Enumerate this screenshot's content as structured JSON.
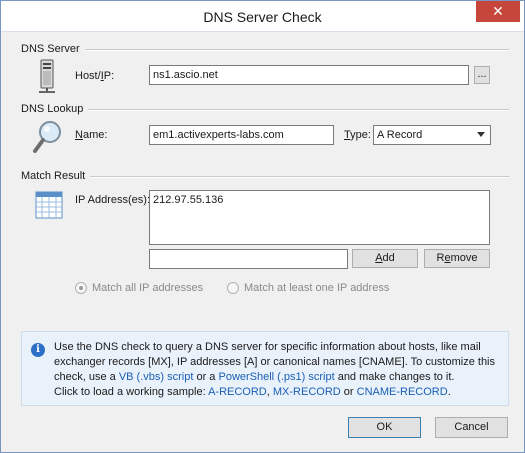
{
  "window": {
    "title": "DNS Server Check",
    "close_glyph": "✕"
  },
  "dns_server": {
    "section_label": "DNS Server",
    "host_label_pre": "Host/",
    "host_label_u": "I",
    "host_label_post": "P:",
    "host_value": "ns1.ascio.net",
    "browse_label": "..."
  },
  "dns_lookup": {
    "section_label": "DNS Lookup",
    "name_label_u": "N",
    "name_label_post": "ame:",
    "name_value": "em1.activexperts-labs.com",
    "type_label_u": "T",
    "type_label_post": "ype:",
    "type_value": "A Record"
  },
  "match_result": {
    "section_label": "Match Result",
    "ip_label": "IP Address(es):",
    "ip_list": [
      "212.97.55.136"
    ],
    "new_ip_value": "",
    "add_label_u": "A",
    "add_label_post": "dd",
    "remove_label_pre": "R",
    "remove_label_u": "e",
    "remove_label_post": "move",
    "radio_all": "Match all IP addresses",
    "radio_one": "Match at least one IP address"
  },
  "info": {
    "line1": "Use the DNS check to query a DNS server for specific information about hosts, like mail",
    "line2": "exchanger records [MX], IP addresses [A] or canonical names [CNAME]. To customize this",
    "line3_pre": "check, use a ",
    "vb_link": "VB (.vbs) script",
    "line3_mid": " or a ",
    "ps_link": "PowerShell (.ps1) script",
    "line3_post": " and make changes to it.",
    "line4_pre": "Click to load a working sample: ",
    "sample_a": "A-RECORD",
    "sep1": ", ",
    "sample_mx": "MX-RECORD",
    "sep2": " or ",
    "sample_cname": "CNAME-RECORD",
    "end": "."
  },
  "footer": {
    "ok_label": "OK",
    "cancel_label": "Cancel"
  }
}
